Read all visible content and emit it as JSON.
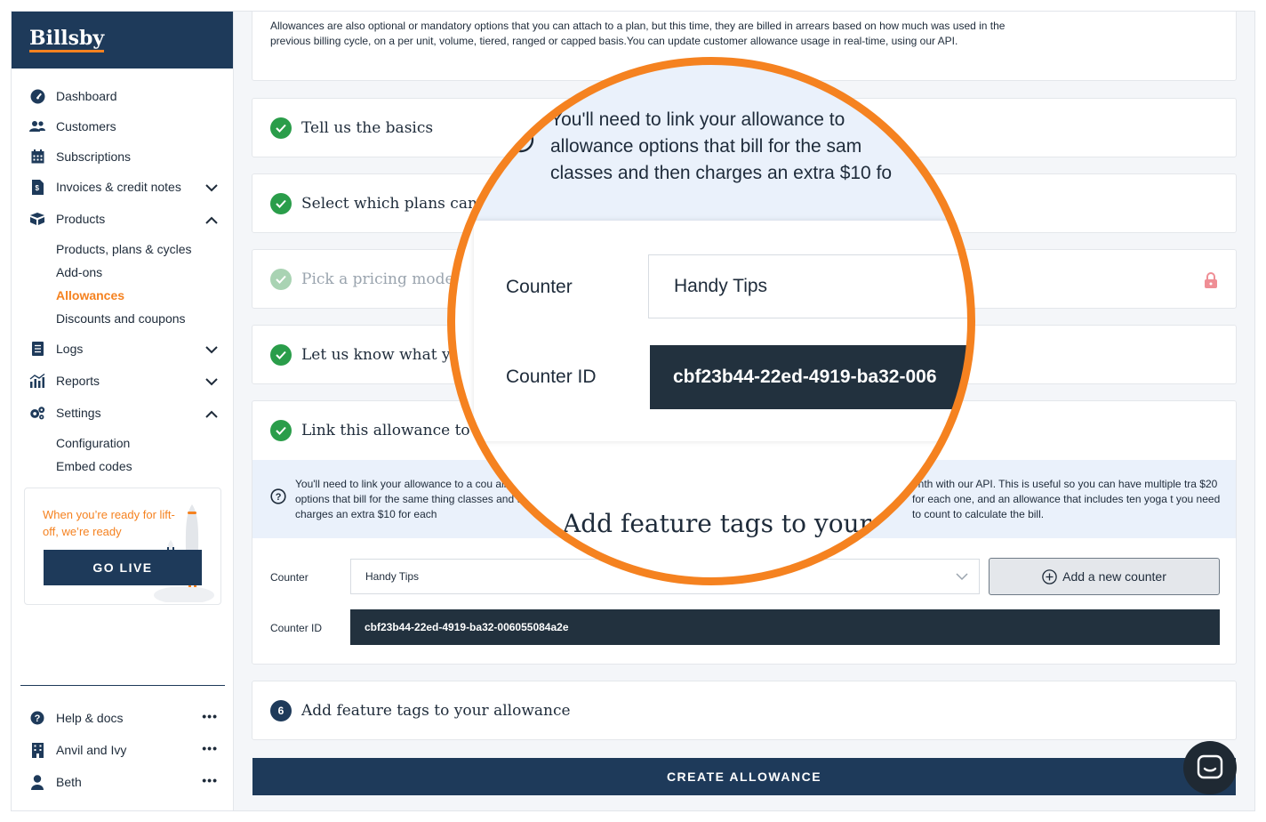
{
  "brand": {
    "name": "Billsby",
    "accent": "#f58220",
    "primary": "#1e3a5a"
  },
  "sidebar": {
    "items": [
      {
        "label": "Dashboard",
        "icon": "dashboard-icon"
      },
      {
        "label": "Customers",
        "icon": "users-icon"
      },
      {
        "label": "Subscriptions",
        "icon": "calendar-icon"
      },
      {
        "label": "Invoices & credit notes",
        "icon": "invoice-icon"
      },
      {
        "label": "Products",
        "icon": "products-icon"
      },
      {
        "label": "Logs",
        "icon": "logs-icon"
      },
      {
        "label": "Reports",
        "icon": "reports-icon"
      },
      {
        "label": "Settings",
        "icon": "settings-icon"
      }
    ],
    "products_sub": [
      "Products, plans & cycles",
      "Add-ons",
      "Allowances",
      "Discounts and coupons"
    ],
    "settings_sub": [
      "Configuration",
      "Embed codes"
    ],
    "golive": {
      "text": "When you’re ready for lift-off, we’re ready",
      "button": "GO LIVE"
    },
    "bottom": [
      {
        "label": "Help & docs",
        "icon": "help-icon"
      },
      {
        "label": "Anvil and Ivy",
        "icon": "building-icon"
      },
      {
        "label": "Beth",
        "icon": "user-icon"
      }
    ],
    "more": "•••"
  },
  "main": {
    "intro": "Allowances are also optional or mandatory options that you can attach to a plan, but this time, they are billed in arrears based on how much was used in the previous billing cycle, on a per unit, volume, tiered, ranged or capped basis.You can update customer allowance usage in real-time, using our API.",
    "steps": [
      {
        "title": "Tell us the basics"
      },
      {
        "title": "Select which plans can h"
      },
      {
        "title": "Pick a pricing model"
      },
      {
        "title": "Let us know what you"
      },
      {
        "title": "Link this allowance to a c"
      }
    ],
    "help_left": "You'll need to link your allowance to a cou allowance options that bill for the same thing classes and then charges an extra $10 for each",
    "help_right": "onth with our API. This is useful so you can have multiple tra $20 for each one, and an allowance that includes ten yoga t you need to count to calculate the bill.",
    "counter_label": "Counter",
    "counter_value": "Handy Tips",
    "add_counter": "Add a new counter",
    "counter_id_label": "Counter ID",
    "counter_id": "cbf23b44-22ed-4919-ba32-006055084a2e",
    "step6_number": "6",
    "step6_title": "Add feature tags to your allowance",
    "create_button": "CREATE ALLOWANCE"
  },
  "magnifier": {
    "help_lines": [
      "You'll need to link your allowance to",
      "allowance options that bill for the sam",
      "classes and then charges an extra $10 fo"
    ],
    "counter_label": "Counter",
    "counter_value": "Handy Tips",
    "counter_id_label": "Counter ID",
    "counter_id": "cbf23b44-22ed-4919-ba32-006",
    "tags_title": "Add feature tags to your"
  }
}
